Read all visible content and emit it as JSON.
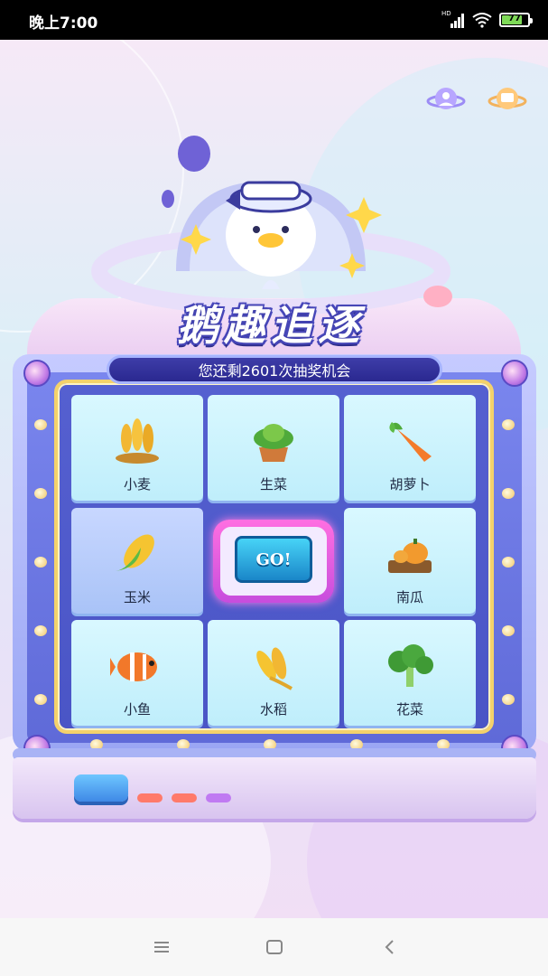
{
  "status_bar": {
    "time": "晚上7:00",
    "signal_label": "HD",
    "battery_level": "77"
  },
  "game": {
    "title": "鹅趣追逐",
    "chances_text": "您还剩2601次抽奖机会",
    "go_label": "GO!",
    "prizes": [
      {
        "name": "小麦",
        "icon": "wheat-icon"
      },
      {
        "name": "生菜",
        "icon": "lettuce-icon"
      },
      {
        "name": "胡萝卜",
        "icon": "carrot-icon"
      },
      {
        "name": "玉米",
        "icon": "corn-icon"
      },
      {
        "name": "南瓜",
        "icon": "pumpkin-icon"
      },
      {
        "name": "小鱼",
        "icon": "fish-icon"
      },
      {
        "name": "水稻",
        "icon": "rice-icon"
      },
      {
        "name": "花菜",
        "icon": "broccoli-icon"
      }
    ]
  },
  "colors": {
    "accent_blue": "#3e3da8",
    "go_button": "#1a86c9",
    "frame_gold": "#f4d26b"
  },
  "nav": {
    "menu_icon": "menu-icon",
    "home_icon": "home-icon",
    "back_icon": "back-icon"
  }
}
